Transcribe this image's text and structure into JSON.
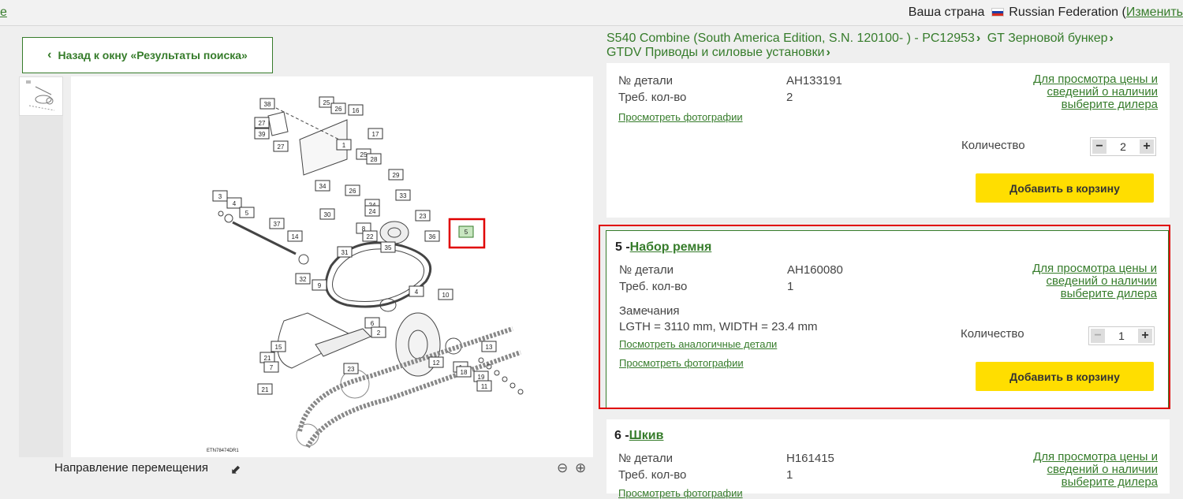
{
  "topbar": {
    "edge_link": "e",
    "country_label": "Ваша страна",
    "country_name": "Russian Federation",
    "change_link": "Изменить"
  },
  "back_button": {
    "label": "Назад к окну «Результаты поиска»"
  },
  "breadcrumb": {
    "item1": "S540 Combine (South America Edition, S.N. 120100- ) - PC12953",
    "item2": "GT Зерновой бункер",
    "item3": "GTDV Приводы и силовые установки"
  },
  "diagram": {
    "code": "ETN78474DR1",
    "callouts": [
      "38",
      "25",
      "26",
      "16",
      "27",
      "39",
      "27",
      "17",
      "1",
      "25",
      "28",
      "34",
      "29",
      "26",
      "33",
      "24",
      "24",
      "3",
      "4",
      "5",
      "30",
      "23",
      "37",
      "14",
      "8",
      "22",
      "36",
      "31",
      "35",
      "32",
      "9",
      "4",
      "10",
      "6",
      "2",
      "15",
      "21",
      "7",
      "13",
      "12",
      "1",
      "23",
      "18",
      "19",
      "11",
      "21"
    ],
    "highlighted": "5"
  },
  "footer": {
    "direction_label": "Направление перемещения"
  },
  "parts": [
    {
      "part_no_label": "№ детали",
      "part_no": "AH133191",
      "qty_req_label": "Треб. кол-во",
      "qty_req": "2",
      "photos_link": "Просмотреть фотографии",
      "dealer_link": "Для просмотра цены и сведений о наличии выберите дилера",
      "qty_label": "Количество",
      "qty": "2",
      "add_to_cart": "Добавить в корзину"
    },
    {
      "index": "5 -",
      "name": "Набор ремня",
      "part_no_label": "№ детали",
      "part_no": "AH160080",
      "qty_req_label": "Треб. кол-во",
      "qty_req": "1",
      "notes_label": "Замечания",
      "notes": "LGTH = 3110 mm, WIDTH = 23.4 mm",
      "similar_link": "Посмотреть аналогичные детали",
      "photos_link": "Просмотреть фотографии",
      "dealer_link": "Для просмотра цены и сведений о наличии выберите дилера",
      "qty_label": "Количество",
      "qty": "1",
      "add_to_cart": "Добавить в корзину"
    },
    {
      "index": "6 -",
      "name": "Шкив",
      "part_no_label": "№ детали",
      "part_no": "H161415",
      "qty_req_label": "Треб. кол-во",
      "qty_req": "1",
      "photos_link": "Просмотреть фотографии",
      "dealer_link": "Для просмотра цены и сведений о наличии выберите дилера"
    }
  ],
  "colors": {
    "brand_green": "#367c2b",
    "button_yellow": "#ffde00",
    "highlight_red": "#e00000"
  }
}
